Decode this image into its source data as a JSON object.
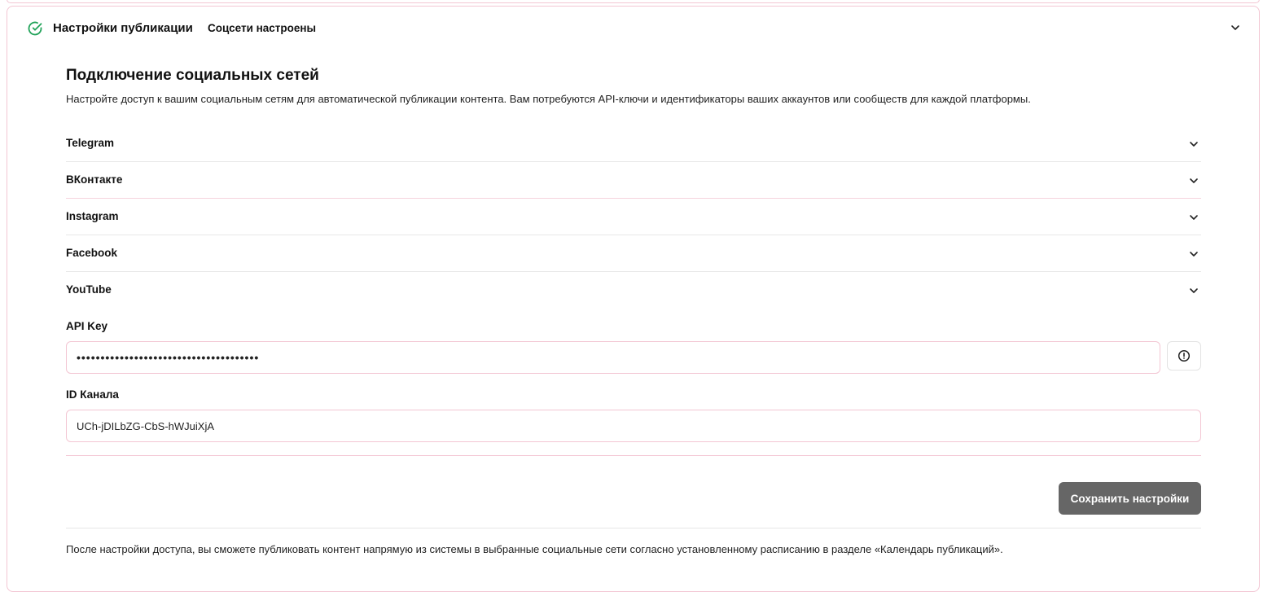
{
  "header": {
    "title": "Настройки публикации",
    "status": "Соцсети настроены",
    "status_icon": "check-circle-icon",
    "status_color": "#22a35a"
  },
  "section": {
    "title": "Подключение социальных сетей",
    "description": "Настройте доступ к вашим социальным сетям для автоматической публикации контента. Вам потребуются API-ключи и идентификаторы ваших аккаунтов или сообществ для каждой платформы."
  },
  "platforms": [
    {
      "label": "Telegram"
    },
    {
      "label": "ВКонтакте"
    },
    {
      "label": "Instagram"
    },
    {
      "label": "Facebook"
    },
    {
      "label": "YouTube"
    }
  ],
  "youtube_form": {
    "api_key_label": "API Key",
    "api_key_value": "••••••••••••••••••••••••••••••••••••••",
    "info_icon": "info-circle-icon",
    "channel_label": "ID Канала",
    "channel_value": "UCh-jDILbZG-CbS-hWJuiXjA"
  },
  "actions": {
    "save_label": "Сохранить настройки",
    "save_color": "#666666"
  },
  "footer": {
    "note": "После настройки доступа, вы сможете публиковать контент напрямую из системы в выбранные социальные сети согласно установленному расписанию в разделе «Календарь публикаций»."
  },
  "colors": {
    "border_accent": "#f3c6d3"
  }
}
